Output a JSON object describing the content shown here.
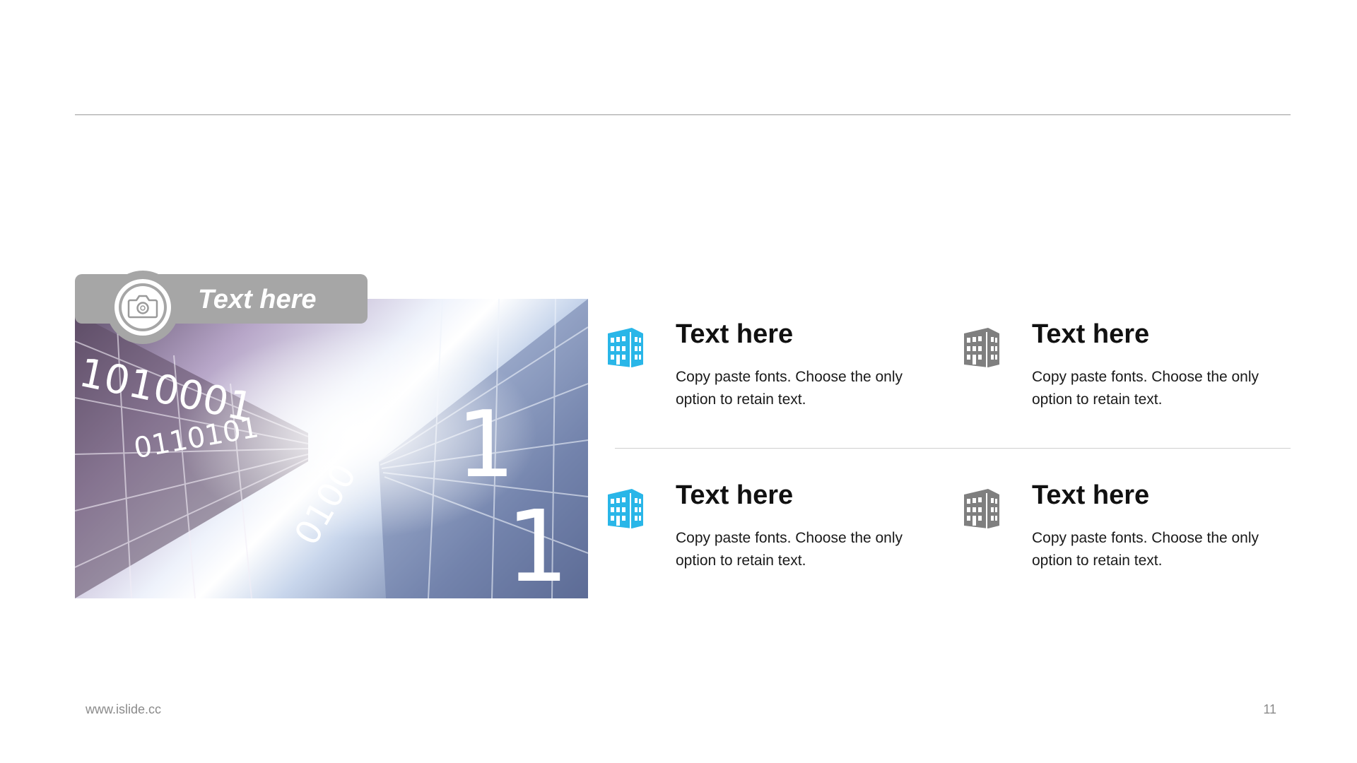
{
  "photo_caption": "Text here",
  "items": [
    {
      "title": "Text here",
      "body": "Copy paste fonts. Choose the only option to retain text.",
      "icon": "building-icon",
      "color": "#29b6e8"
    },
    {
      "title": "Text here",
      "body": "Copy paste fonts. Choose the only option to retain text.",
      "icon": "building-icon",
      "color": "#7f7f7f"
    },
    {
      "title": "Text here",
      "body": "Copy paste fonts. Choose the only option to retain text.",
      "icon": "building-icon",
      "color": "#29b6e8"
    },
    {
      "title": "Text here",
      "body": "Copy paste fonts. Choose the only option to retain text.",
      "icon": "building-icon",
      "color": "#7f7f7f"
    }
  ],
  "photo_binary": [
    "1010001",
    "0110101",
    "0100",
    "1",
    "1"
  ],
  "footer": {
    "url": "www.islide.cc",
    "page_number": "11"
  }
}
